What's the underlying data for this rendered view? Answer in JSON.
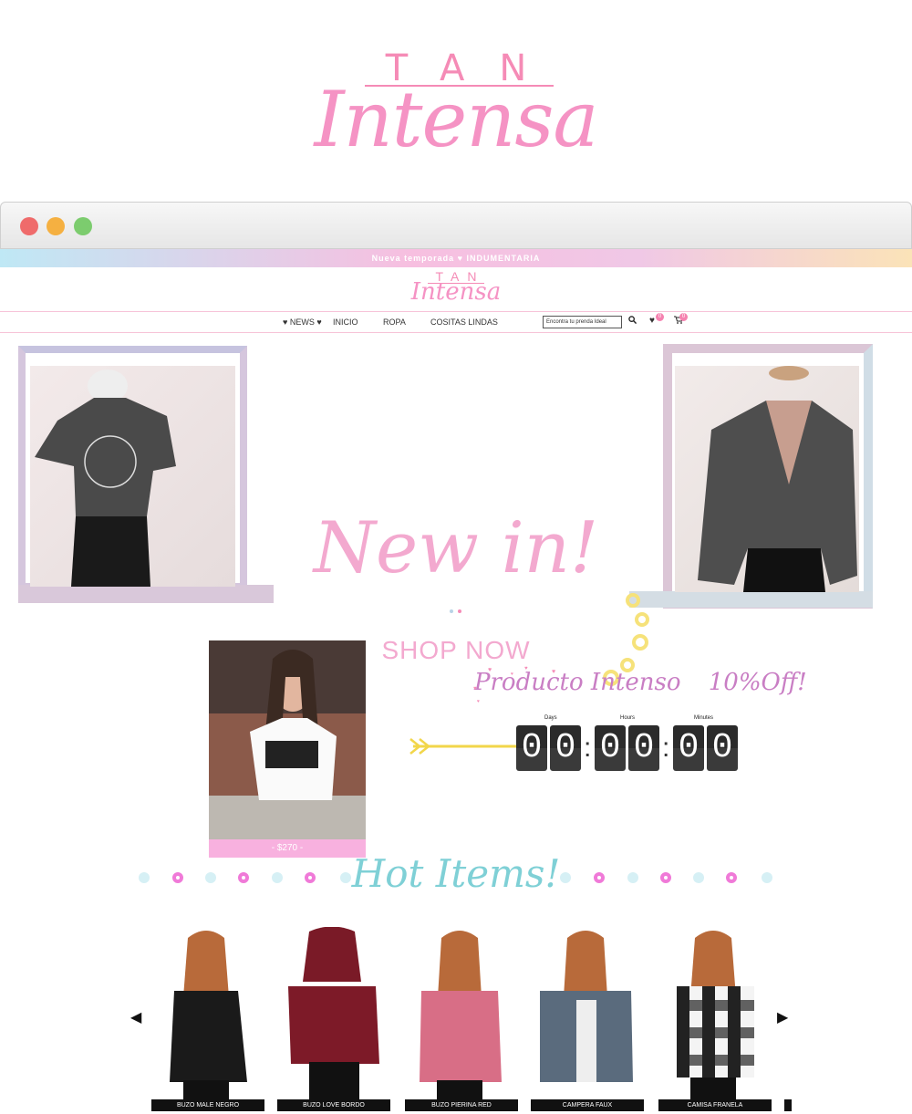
{
  "hero": {
    "tan": "TAN",
    "intensa": "Intensa"
  },
  "browser": {
    "dots": [
      "#ef6b6b",
      "#f5b041",
      "#7ccc6e"
    ]
  },
  "announcement": "Nueva temporada ♥ INDUMENTARIA",
  "site_logo": {
    "tan": "TAN",
    "intensa": "Intensa"
  },
  "nav": {
    "items": [
      "♥ NEWS ♥",
      "INICIO",
      "ROPA",
      "COSITAS LINDAS"
    ],
    "search_placeholder": "Encontra tu prenda Ideal",
    "wishlist_count": "0",
    "cart_count": "0"
  },
  "slider": {
    "headline": "New in!",
    "cta": "SHOP NOW"
  },
  "promo": {
    "price": "- $270 -",
    "title": "Producto Intenso",
    "discount": "10%Off!",
    "countdown": {
      "labels": [
        "Days",
        "Hours",
        "Minutes"
      ],
      "digits": [
        "0",
        "0",
        "0",
        "0",
        "0",
        "0"
      ]
    }
  },
  "hot_items": {
    "title": "Hot Items!",
    "products": [
      "BUZO MALE NEGRO",
      "BUZO LOVE BORDO",
      "BUZO PIERINA RED",
      "CAMPERA FAUX",
      "CAMISA FRANELA"
    ]
  },
  "colors": {
    "pink": "#f58bb6",
    "teal": "#7fd0d6",
    "purple": "#c97ec4"
  }
}
